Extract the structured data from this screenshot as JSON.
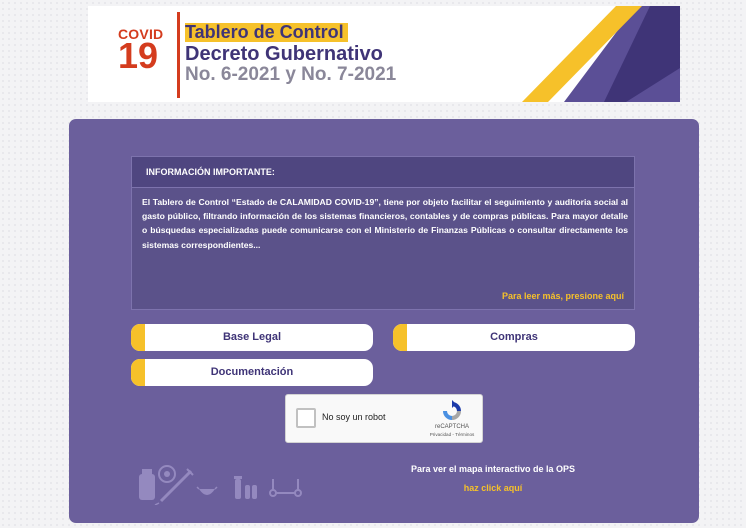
{
  "header": {
    "covid_word": "COVID",
    "covid_number": "19",
    "title_line1": "Tablero de Control",
    "title_line2": "Decreto Gubernativo",
    "title_line3": "No. 6-2021 y No. 7-2021"
  },
  "info": {
    "heading": "INFORMACIÓN IMPORTANTE:",
    "body": "El Tablero de Control “Estado de CALAMIDAD COVID-19”, tiene por objeto facilitar el seguimiento y auditoria social al gasto público, filtrando información de los sistemas financieros, contables y de compras públicas. Para mayor detalle o búsquedas especializadas puede comunicarse con el Ministerio de Finanzas Públicas o consultar directamente los sistemas correspondientes...",
    "read_more": "Para leer más, presione aquí"
  },
  "buttons": {
    "base_legal": "Base Legal",
    "compras": "Compras",
    "documentacion": "Documentación"
  },
  "captcha": {
    "label": "No soy un robot",
    "brand": "reCAPTCHA",
    "links": "Privacidad - Términos"
  },
  "map": {
    "text": "Para ver el mapa interactivo de la OPS",
    "link": "haz click aquí"
  },
  "colors": {
    "panel": "#6b5f9c",
    "accent_yellow": "#f6c12a",
    "brand_red": "#d43c1e",
    "brand_purple": "#3f3477"
  },
  "icons": [
    "vaccine-icon",
    "syringe-icon",
    "mask-icon",
    "vials-icon",
    "stethoscope-icon",
    "recaptcha-icon"
  ]
}
